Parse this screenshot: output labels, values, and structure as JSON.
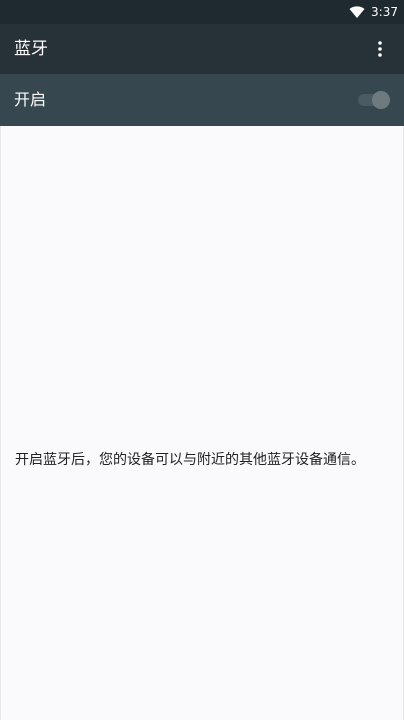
{
  "status_bar": {
    "time": "3:37",
    "wifi_icon": "wifi-icon",
    "background": "#1f2a30"
  },
  "app_bar": {
    "title": "蓝牙",
    "overflow_icon": "more-vert-icon",
    "background": "#263238"
  },
  "bluetooth_switch": {
    "label": "开启",
    "state": "off",
    "background": "#37474f"
  },
  "content": {
    "info_text": "开启蓝牙后，您的设备可以与附近的其他蓝牙设备通信。",
    "background": "#fafafc"
  }
}
